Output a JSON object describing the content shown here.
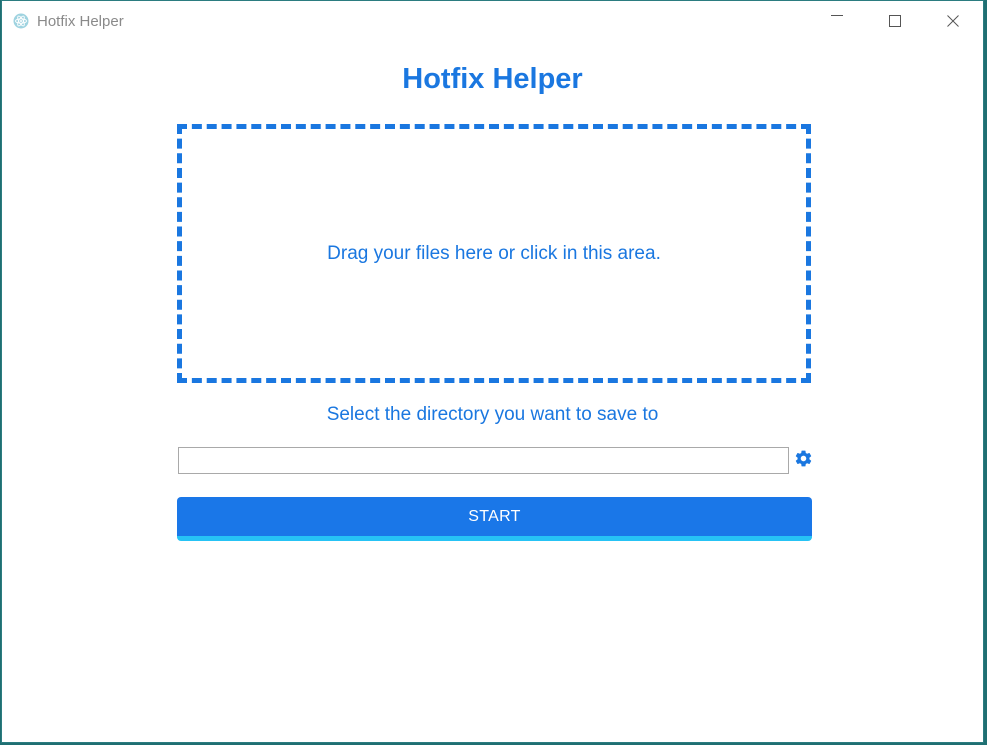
{
  "window": {
    "title": "Hotfix Helper",
    "app_icon": "electron-icon",
    "controls": {
      "minimize_icon": "minimize-icon",
      "maximize_icon": "maximize-icon",
      "close_icon": "close-icon"
    }
  },
  "main": {
    "heading": "Hotfix Helper",
    "dropzone_text": "Drag your files here or click in this area.",
    "directory_label": "Select the directory you want to save to",
    "directory_input": {
      "value": "",
      "placeholder": ""
    },
    "settings_icon": "gear-icon",
    "start_label": "START"
  },
  "colors": {
    "accent": "#1a77e0",
    "button_bg": "#1a77e8",
    "button_underline": "#26c3f5",
    "title_text": "#8a8a8a"
  }
}
